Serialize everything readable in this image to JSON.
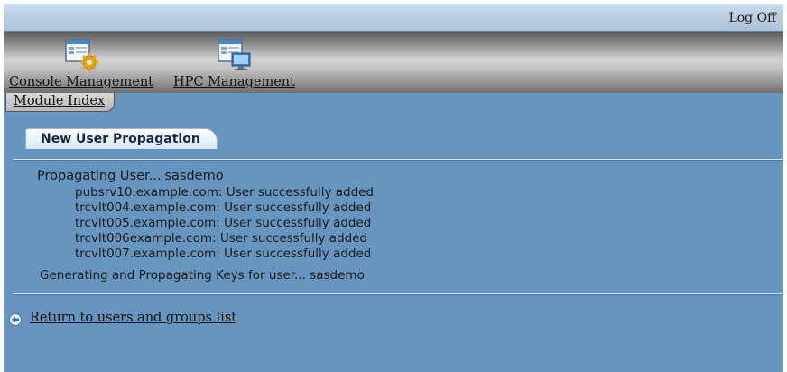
{
  "header": {
    "logoff_label": "Log Off"
  },
  "apps": [
    {
      "label": "Console Management",
      "icon": "console-management-icon"
    },
    {
      "label": "HPC Management",
      "icon": "hpc-management-icon"
    }
  ],
  "module_tab": {
    "label": "Module Index"
  },
  "section": {
    "title": "New User Propagation"
  },
  "propagation": {
    "label": "Propagating User...",
    "user": "sasdemo",
    "results": [
      "pubsrv10.example.com: User successfully added",
      "trcvlt004.example.com: User successfully added",
      "trcvlt005.example.com: User successfully added",
      "trcvlt006example.com: User successfully added",
      "trcvlt007.example.com: User successfully added"
    ],
    "keys_label": "Generating and Propagating Keys for user...",
    "keys_user": "sasdemo"
  },
  "footer": {
    "return_label": "Return to users and groups list",
    "return_icon": "back-arrow-icon"
  },
  "colors": {
    "page_bg": "#6795c0",
    "tab_text": "#15244a"
  }
}
